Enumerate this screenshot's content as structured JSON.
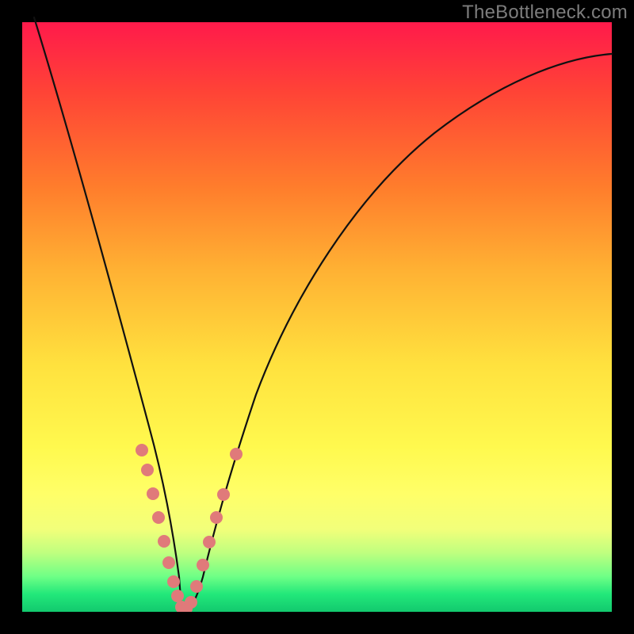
{
  "watermark": "TheBottleneck.com",
  "colors": {
    "frame": "#000000",
    "gradient_top": "#ff1a4b",
    "gradient_bottom": "#12c96e",
    "curve": "#111111",
    "marker": "#e07a7a",
    "watermark_text": "#7d7d7d"
  },
  "chart_data": {
    "type": "line",
    "title": "",
    "xlabel": "",
    "ylabel": "",
    "xlim": [
      0,
      100
    ],
    "ylim": [
      0,
      100
    ],
    "grid": false,
    "legend": false,
    "series": [
      {
        "name": "bottleneck-curve",
        "x": [
          2,
          5,
          10,
          15,
          18,
          20,
          22,
          24,
          25,
          26,
          27,
          28,
          30,
          33,
          35,
          40,
          50,
          60,
          70,
          80,
          90,
          100
        ],
        "y": [
          100,
          86,
          64,
          42,
          30,
          22,
          13,
          6,
          3,
          1,
          0,
          1,
          4,
          12,
          20,
          33,
          52,
          65,
          74,
          81,
          86,
          90
        ]
      }
    ],
    "markers": [
      {
        "x": 19,
        "y": 27
      },
      {
        "x": 20,
        "y": 23
      },
      {
        "x": 21,
        "y": 18
      },
      {
        "x": 22,
        "y": 13
      },
      {
        "x": 23,
        "y": 9
      },
      {
        "x": 24,
        "y": 6
      },
      {
        "x": 25,
        "y": 3
      },
      {
        "x": 26,
        "y": 1
      },
      {
        "x": 27,
        "y": 0
      },
      {
        "x": 28,
        "y": 1
      },
      {
        "x": 29,
        "y": 3
      },
      {
        "x": 30,
        "y": 6
      },
      {
        "x": 31,
        "y": 10
      },
      {
        "x": 32,
        "y": 14
      },
      {
        "x": 33,
        "y": 17
      },
      {
        "x": 34,
        "y": 20
      },
      {
        "x": 36,
        "y": 27
      }
    ],
    "notch_x": 27
  }
}
